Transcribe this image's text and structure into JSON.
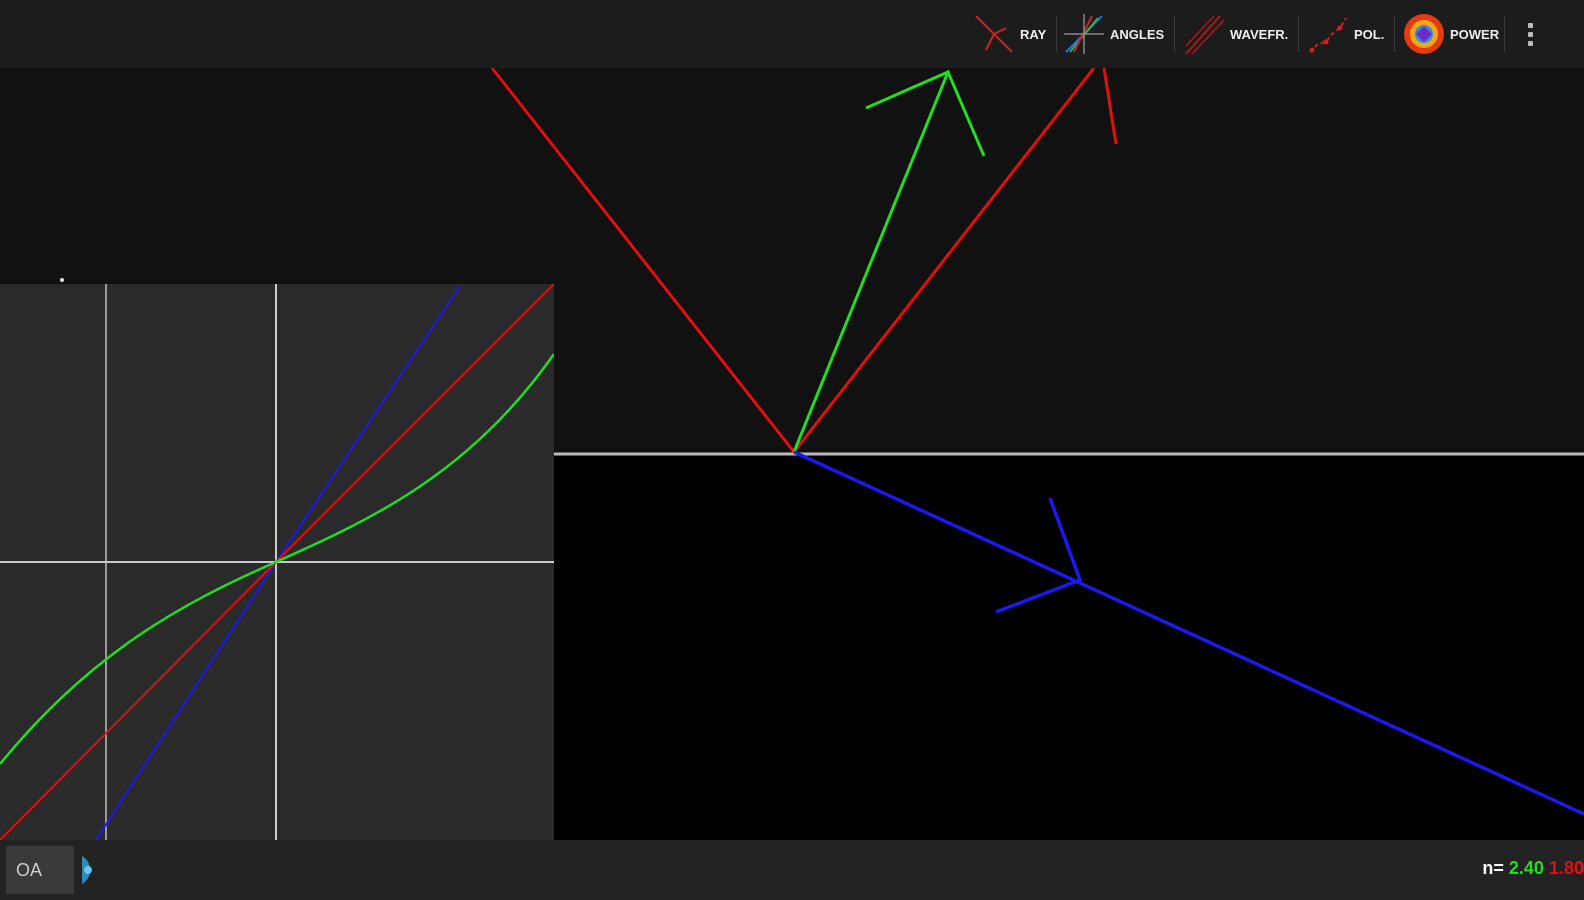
{
  "toolbar": {
    "buttons": [
      {
        "id": "ray",
        "label": "RAY",
        "icon": "ray-icon"
      },
      {
        "id": "angles",
        "label": "ANGLES",
        "icon": "angles-icon"
      },
      {
        "id": "wavefront",
        "label": "WAVEFR.",
        "icon": "wavefront-icon"
      },
      {
        "id": "polarization",
        "label": "POL.",
        "icon": "polarization-icon"
      },
      {
        "id": "power",
        "label": "POWER",
        "icon": "power-icon"
      }
    ],
    "menu_icon": "overflow-menu-icon"
  },
  "bottom": {
    "oa_label": "OA",
    "knob_icon": "rotation-knob-icon",
    "n_prefix": "n=",
    "n1": "2.40",
    "n2": "1.80"
  },
  "colors": {
    "incident": "#e01010",
    "reflected": "#e01010",
    "ordinary": "#22dd22",
    "transmitted": "#1a1aee",
    "interface": "#bbbbbb",
    "plot_bg": "#2a2a2a"
  }
}
